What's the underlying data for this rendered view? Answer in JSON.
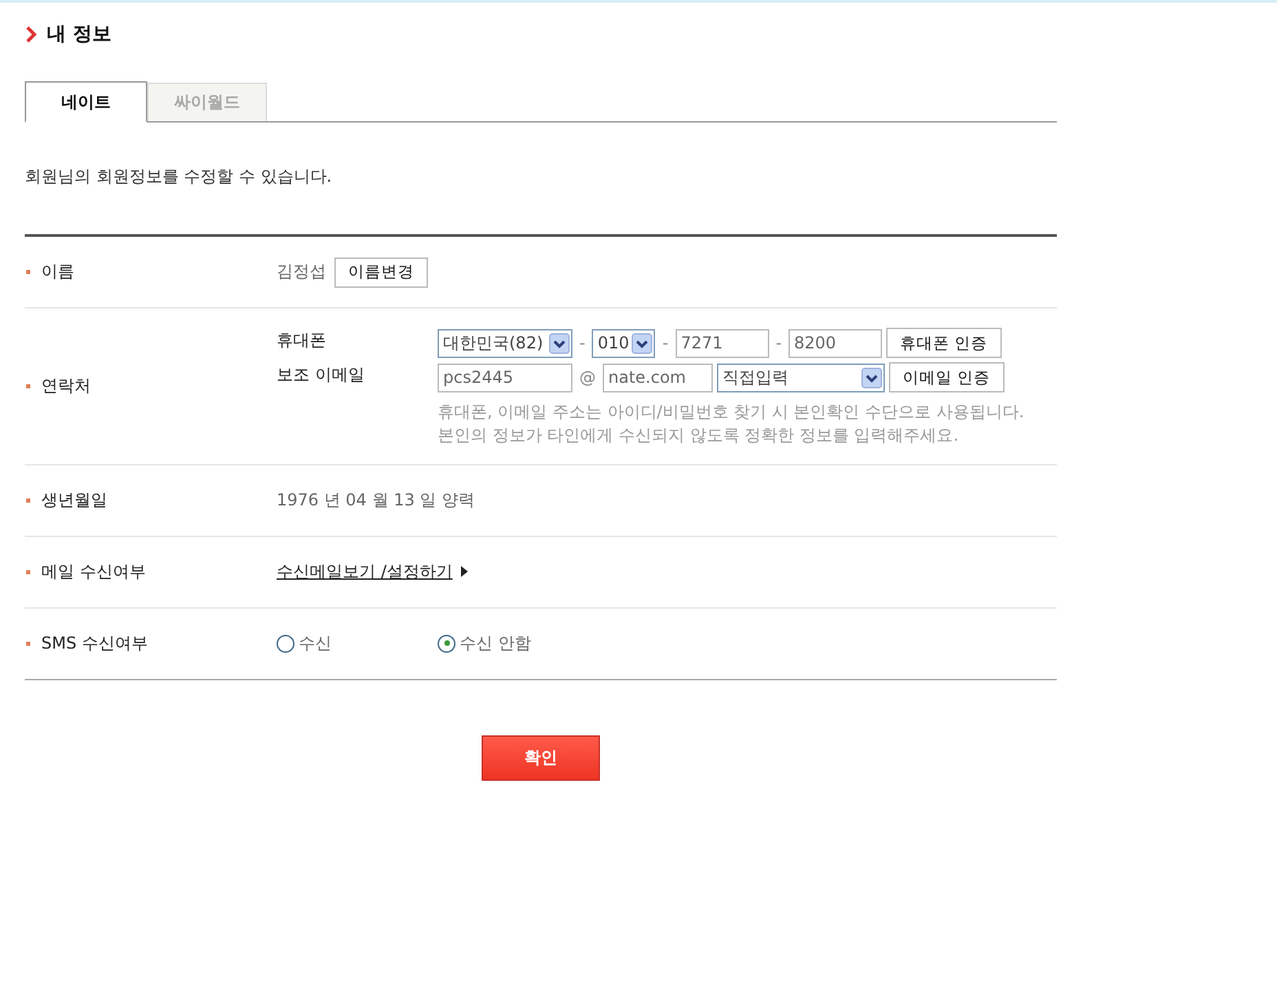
{
  "page_title": "내 정보",
  "tabs": [
    {
      "label": "네이트",
      "selected": true
    },
    {
      "label": "싸이월드",
      "selected": false
    }
  ],
  "intro": "회원님의 회원정보를 수정할 수 있습니다.",
  "rows": [
    {
      "kind": "name",
      "label": "이름",
      "value": "김정섭",
      "button": "이름변경"
    },
    {
      "kind": "contact",
      "label": "연락처",
      "phone": {
        "label": "휴대폰",
        "country": "대한민국(82)",
        "separator": "-",
        "prefix": "010",
        "middle": "7271",
        "last": "8200",
        "button": "휴대폰 인증"
      },
      "email": {
        "label": "보조 이메일",
        "id": "pcs2445",
        "at": "@",
        "domain": "nate.com",
        "domain_select": "직접입력",
        "button": "이메일 인증"
      },
      "note": "휴대폰, 이메일 주소는 아이디/비밀번호 찾기 시 본인확인 수단으로 사용됩니다.\n본인의 정보가 타인에게 수신되지 않도록 정확한 정보를 입력해주세요."
    },
    {
      "kind": "text",
      "label": "생년월일",
      "value": "1976 년 04 월 13 일  양력"
    },
    {
      "kind": "link",
      "label": "메일 수신여부",
      "link": "수신메일보기 /설정하기"
    },
    {
      "kind": "radio",
      "label": "SMS 수신여부",
      "options": [
        {
          "label": "수신",
          "selected": false
        },
        {
          "label": "수신 안함",
          "selected": true
        }
      ]
    }
  ],
  "confirm_button": "확인"
}
